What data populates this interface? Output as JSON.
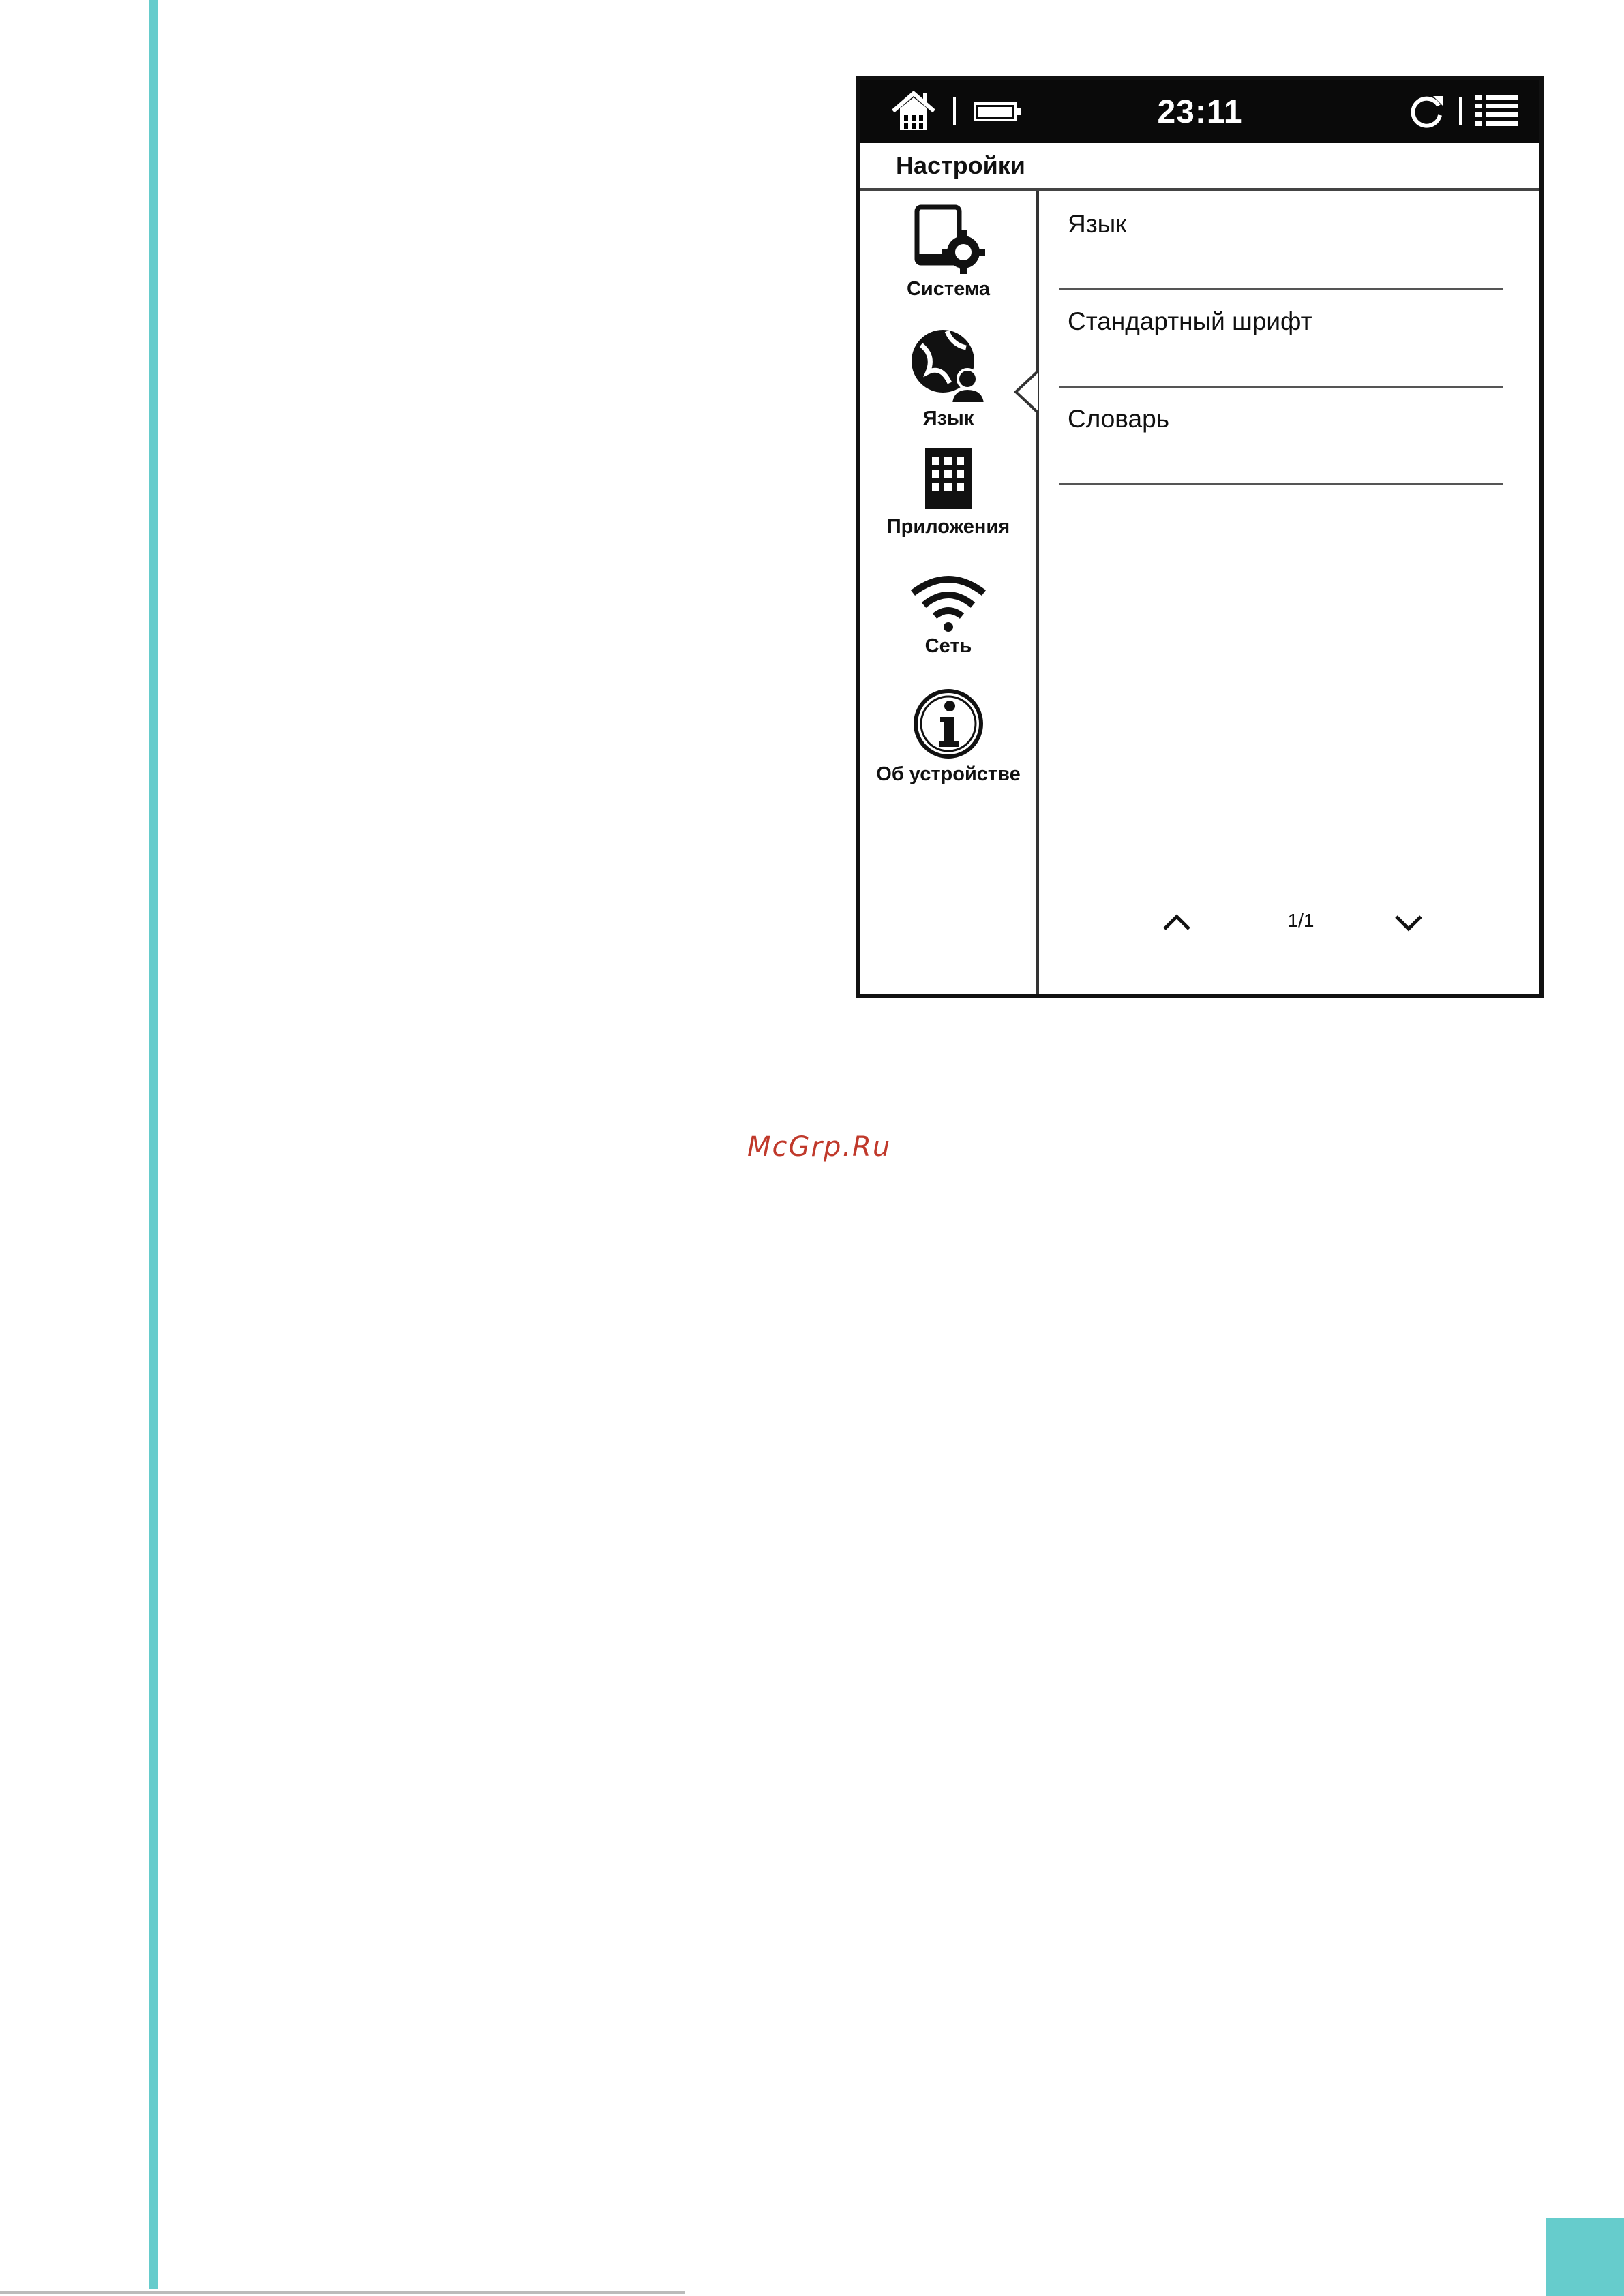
{
  "status_bar": {
    "time": "23:11",
    "icons": [
      "home-icon",
      "battery-icon",
      "sync-icon",
      "menu-list-icon"
    ]
  },
  "header": {
    "title": "Настройки"
  },
  "sidebar": {
    "items": [
      {
        "label": "Система",
        "icon": "system-settings-icon"
      },
      {
        "label": "Язык",
        "icon": "language-globe-icon",
        "selected": true
      },
      {
        "label": "Приложения",
        "icon": "apps-grid-icon"
      },
      {
        "label": "Сеть",
        "icon": "wifi-icon"
      },
      {
        "label": "Об устройстве",
        "icon": "info-icon"
      }
    ]
  },
  "main": {
    "items": [
      {
        "label": "Язык"
      },
      {
        "label": "Стандартный шрифт"
      },
      {
        "label": "Словарь"
      }
    ]
  },
  "pager": {
    "page": "1/1"
  },
  "watermark": "McGrp.Ru",
  "colors": {
    "accent": "#66cccc",
    "statusbar": "#0a0a0a",
    "watermark": "#c0392b"
  }
}
